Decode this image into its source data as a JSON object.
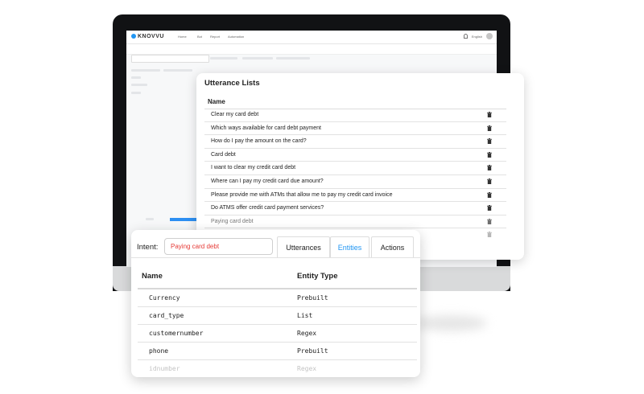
{
  "app": {
    "logo_text": "KNOVVU",
    "nav": [
      "Home",
      "Bot",
      "Report",
      "Automation"
    ],
    "lang": "English"
  },
  "utterance_lists": {
    "title": "Utterance Lists",
    "column_name": "Name",
    "items": [
      "Clear my card debt",
      "Which ways available for card debt payment",
      "How do I pay the amount on the card?",
      "Card debt",
      "I want to clear my credit card debt",
      "Where can I pay my credit card due amount?",
      "Please provide me with ATMs that allow me to pay my credit card invoice",
      "Do ATMS offer credit card payment services?",
      "Paying card debt"
    ]
  },
  "intent": {
    "label": "Intent:",
    "value": "Paying card debt",
    "tabs": [
      {
        "label": "Utterances",
        "active": false
      },
      {
        "label": "Entities",
        "active": true
      },
      {
        "label": "Actions",
        "active": false
      }
    ]
  },
  "entities": {
    "columns": [
      "Name",
      "Entity Type"
    ],
    "rows": [
      {
        "name": "Currency",
        "type": "Prebuilt"
      },
      {
        "name": "card_type",
        "type": "List"
      },
      {
        "name": "customernumber",
        "type": "Regex"
      },
      {
        "name": "phone",
        "type": "Prebuilt"
      },
      {
        "name": "idnumber",
        "type": "Regex"
      }
    ]
  },
  "colors": {
    "accent": "#2196f3",
    "intent_value": "#e53935",
    "monitor": "#111214"
  }
}
